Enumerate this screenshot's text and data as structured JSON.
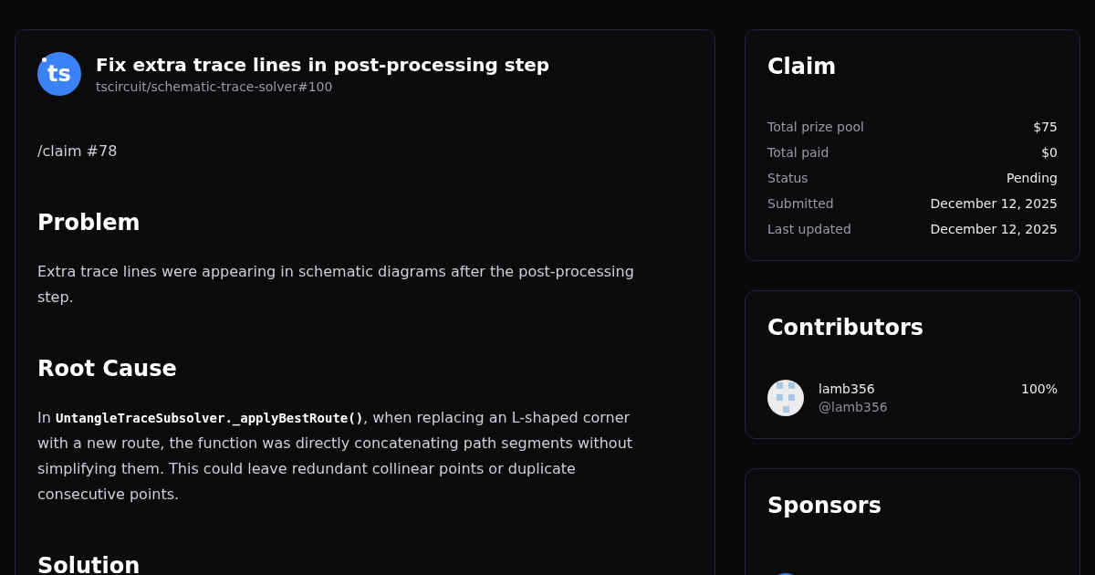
{
  "issue": {
    "logo_text": "ts",
    "title": "Fix extra trace lines in post-processing step",
    "repo_ref": "tscircuit/schematic-trace-solver#100"
  },
  "body": [
    {
      "kind": "paragraph",
      "segments": [
        {
          "kind": "text",
          "text": "/claim #78"
        }
      ]
    },
    {
      "kind": "heading",
      "text": "Problem"
    },
    {
      "kind": "paragraph",
      "segments": [
        {
          "kind": "text",
          "text": "Extra trace lines were appearing in schematic diagrams after the post-processing step."
        }
      ]
    },
    {
      "kind": "heading",
      "text": "Root Cause"
    },
    {
      "kind": "paragraph",
      "segments": [
        {
          "kind": "text",
          "text": "In "
        },
        {
          "kind": "code",
          "text": "UntangleTraceSubsolver._applyBestRoute()"
        },
        {
          "kind": "text",
          "text": ", when replacing an L-shaped corner with a new route, the function was directly concatenating path segments without simplifying them. This could leave redundant collinear points or duplicate consecutive points."
        }
      ]
    },
    {
      "kind": "heading",
      "text": "Solution"
    }
  ],
  "claim": {
    "title": "Claim",
    "rows": [
      {
        "label": "Total prize pool",
        "value": "$75"
      },
      {
        "label": "Total paid",
        "value": "$0"
      },
      {
        "label": "Status",
        "value": "Pending"
      },
      {
        "label": "Submitted",
        "value": "December 12, 2025"
      },
      {
        "label": "Last updated",
        "value": "December 12, 2025"
      }
    ]
  },
  "contributors": {
    "title": "Contributors",
    "items": [
      {
        "name": "lamb356",
        "handle": "@lamb356",
        "share": "100%"
      }
    ]
  },
  "sponsors": {
    "title": "Sponsors"
  }
}
